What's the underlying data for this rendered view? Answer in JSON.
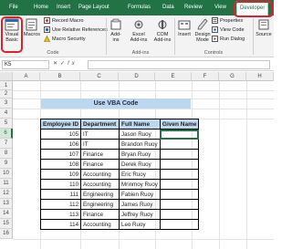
{
  "tabs": [
    "File",
    "Home",
    "Insert",
    "Page Layout",
    "Formulas",
    "Data",
    "Review",
    "View",
    "Developer"
  ],
  "ribbon": {
    "visual_basic": "Visual Basic",
    "macros": "Macros",
    "record_macro": "Record Macro",
    "relative_refs": "Use Relative References",
    "macro_security": "Macro Security",
    "code_group": "Code",
    "addins": "Add-ins",
    "excel_addins": "Excel Add-ins",
    "com_addins": "COM Add-ins",
    "addins_group": "Add-ins",
    "insert": "Insert",
    "design_mode": "Design Mode",
    "properties": "Properties",
    "view_code": "View Code",
    "run_dialog": "Run Dialog",
    "controls_group": "Controls",
    "source": "Source"
  },
  "formula_bar": {
    "name_box": "K5",
    "fx": "fx",
    "value": ""
  },
  "columns": [
    "A",
    "B",
    "C",
    "D",
    "E",
    "F",
    "G",
    "H",
    "K"
  ],
  "rows": [
    "1",
    "2",
    "3",
    "4",
    "5",
    "6",
    "7",
    "8",
    "9",
    "10",
    "11",
    "12",
    "13",
    "14",
    "15",
    "16"
  ],
  "sheet": {
    "title": "Use VBA Code",
    "headers": [
      "Employee ID",
      "Department",
      "Full Name",
      "Given Name"
    ],
    "data": [
      {
        "id": "105",
        "dept": "IT",
        "name": "Jason Ruoy",
        "given": ""
      },
      {
        "id": "106",
        "dept": "IT",
        "name": "Brandon Ruoy",
        "given": ""
      },
      {
        "id": "107",
        "dept": "Finance",
        "name": "Bryan Ruoy",
        "given": ""
      },
      {
        "id": "108",
        "dept": "Finance",
        "name": "Derek Ruoy",
        "given": ""
      },
      {
        "id": "109",
        "dept": "Accounting",
        "name": "Eric Ruoy",
        "given": ""
      },
      {
        "id": "110",
        "dept": "Accounting",
        "name": "Mrinmoy Ruoy",
        "given": ""
      },
      {
        "id": "111",
        "dept": "Engineering",
        "name": "Fabien Ruoy",
        "given": ""
      },
      {
        "id": "112",
        "dept": "Engineering",
        "name": "James Ruoy",
        "given": ""
      },
      {
        "id": "113",
        "dept": "Finance",
        "name": "Jeffrey Ruoy",
        "given": ""
      },
      {
        "id": "114",
        "dept": "Accounting",
        "name": "Leo Ruoy",
        "given": ""
      }
    ]
  },
  "colors": {
    "excel_green": "#217346",
    "highlight_red": "#e0202a",
    "header_fill": "#bdd7ee"
  }
}
